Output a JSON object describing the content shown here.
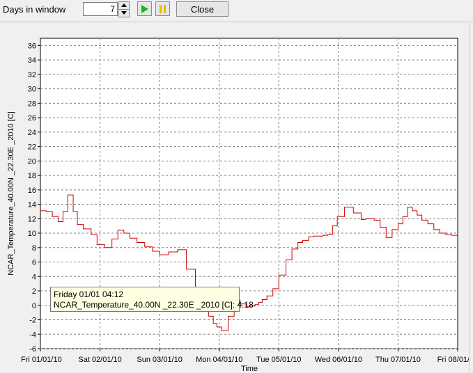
{
  "toolbar": {
    "days_label": "Days in window",
    "days_value": "7",
    "close_label": "Close"
  },
  "tooltip": {
    "line1": "Friday 01/01 04:12",
    "line2": "NCAR_Temperature_40.00N _22.30E _2010 [C]: 4.18"
  },
  "colors": {
    "series": "#cc0000",
    "grid": "#808080",
    "tooltip_bg": "#ffffe1"
  },
  "chart_data": {
    "type": "line",
    "ylabel": "NCAR_Temperature_40.00N _22.30E _2010 [C]",
    "xlabel": "Time",
    "ylim": [
      -6,
      37
    ],
    "xlim": [
      0,
      7
    ],
    "grid": true,
    "yticks": [
      -6,
      -4,
      -2,
      0,
      2,
      4,
      6,
      8,
      10,
      12,
      14,
      16,
      18,
      20,
      22,
      24,
      26,
      28,
      30,
      32,
      34,
      36
    ],
    "xticks": [
      {
        "x": 0,
        "label": "Fri 01/01/10"
      },
      {
        "x": 1,
        "label": "Sat 02/01/10"
      },
      {
        "x": 2,
        "label": "Sun 03/01/10"
      },
      {
        "x": 3,
        "label": "Mon 04/01/10"
      },
      {
        "x": 4,
        "label": "Tue 05/01/10"
      },
      {
        "x": 5,
        "label": "Wed 06/01/10"
      },
      {
        "x": 6,
        "label": "Thu 07/01/10"
      },
      {
        "x": 7,
        "label": "Fri 08/01/10"
      }
    ],
    "series": [
      {
        "x": [
          0,
          0.1,
          0.2,
          0.3,
          0.38,
          0.46,
          0.55,
          0.62,
          0.72,
          0.85,
          0.95,
          1.08,
          1.2,
          1.3,
          1.4,
          1.5,
          1.62,
          1.75,
          1.88,
          2.0,
          2.15,
          2.3,
          2.45,
          2.6,
          2.75,
          2.82,
          2.9,
          2.96,
          3.04,
          3.15,
          3.25,
          3.35,
          3.45,
          3.52,
          3.6,
          3.66,
          3.72,
          3.8,
          3.9,
          4.0,
          4.12,
          4.22,
          4.32,
          4.4,
          4.5,
          4.58,
          4.66,
          4.74,
          4.82,
          4.9,
          4.98,
          5.1,
          5.25,
          5.38,
          5.46,
          5.52,
          5.6,
          5.7,
          5.8,
          5.9,
          6.0,
          6.08,
          6.16,
          6.24,
          6.32,
          6.4,
          6.5,
          6.6,
          6.7,
          6.8,
          6.9,
          7.0
        ],
        "y": [
          13.1,
          13.0,
          12.3,
          11.6,
          13.0,
          15.3,
          13.0,
          11.2,
          10.6,
          9.8,
          8.4,
          8.0,
          9.2,
          10.4,
          10.0,
          9.3,
          8.7,
          8.1,
          7.5,
          7.0,
          7.4,
          7.7,
          5.0,
          1.8,
          0.0,
          -1.5,
          -2.5,
          -3.0,
          -3.5,
          -1.5,
          0.7,
          0.2,
          -0.2,
          -0.1,
          0.1,
          0.4,
          0.8,
          1.3,
          2.3,
          4.2,
          6.3,
          7.8,
          8.7,
          9.0,
          9.5,
          9.6,
          9.6,
          9.7,
          9.8,
          11.0,
          12.3,
          13.6,
          12.8,
          11.9,
          12.0,
          12.0,
          11.8,
          10.8,
          9.4,
          10.5,
          11.3,
          12.3,
          13.6,
          13.1,
          12.5,
          11.8,
          11.3,
          10.5,
          10.0,
          9.8,
          9.7,
          9.7
        ]
      }
    ]
  }
}
